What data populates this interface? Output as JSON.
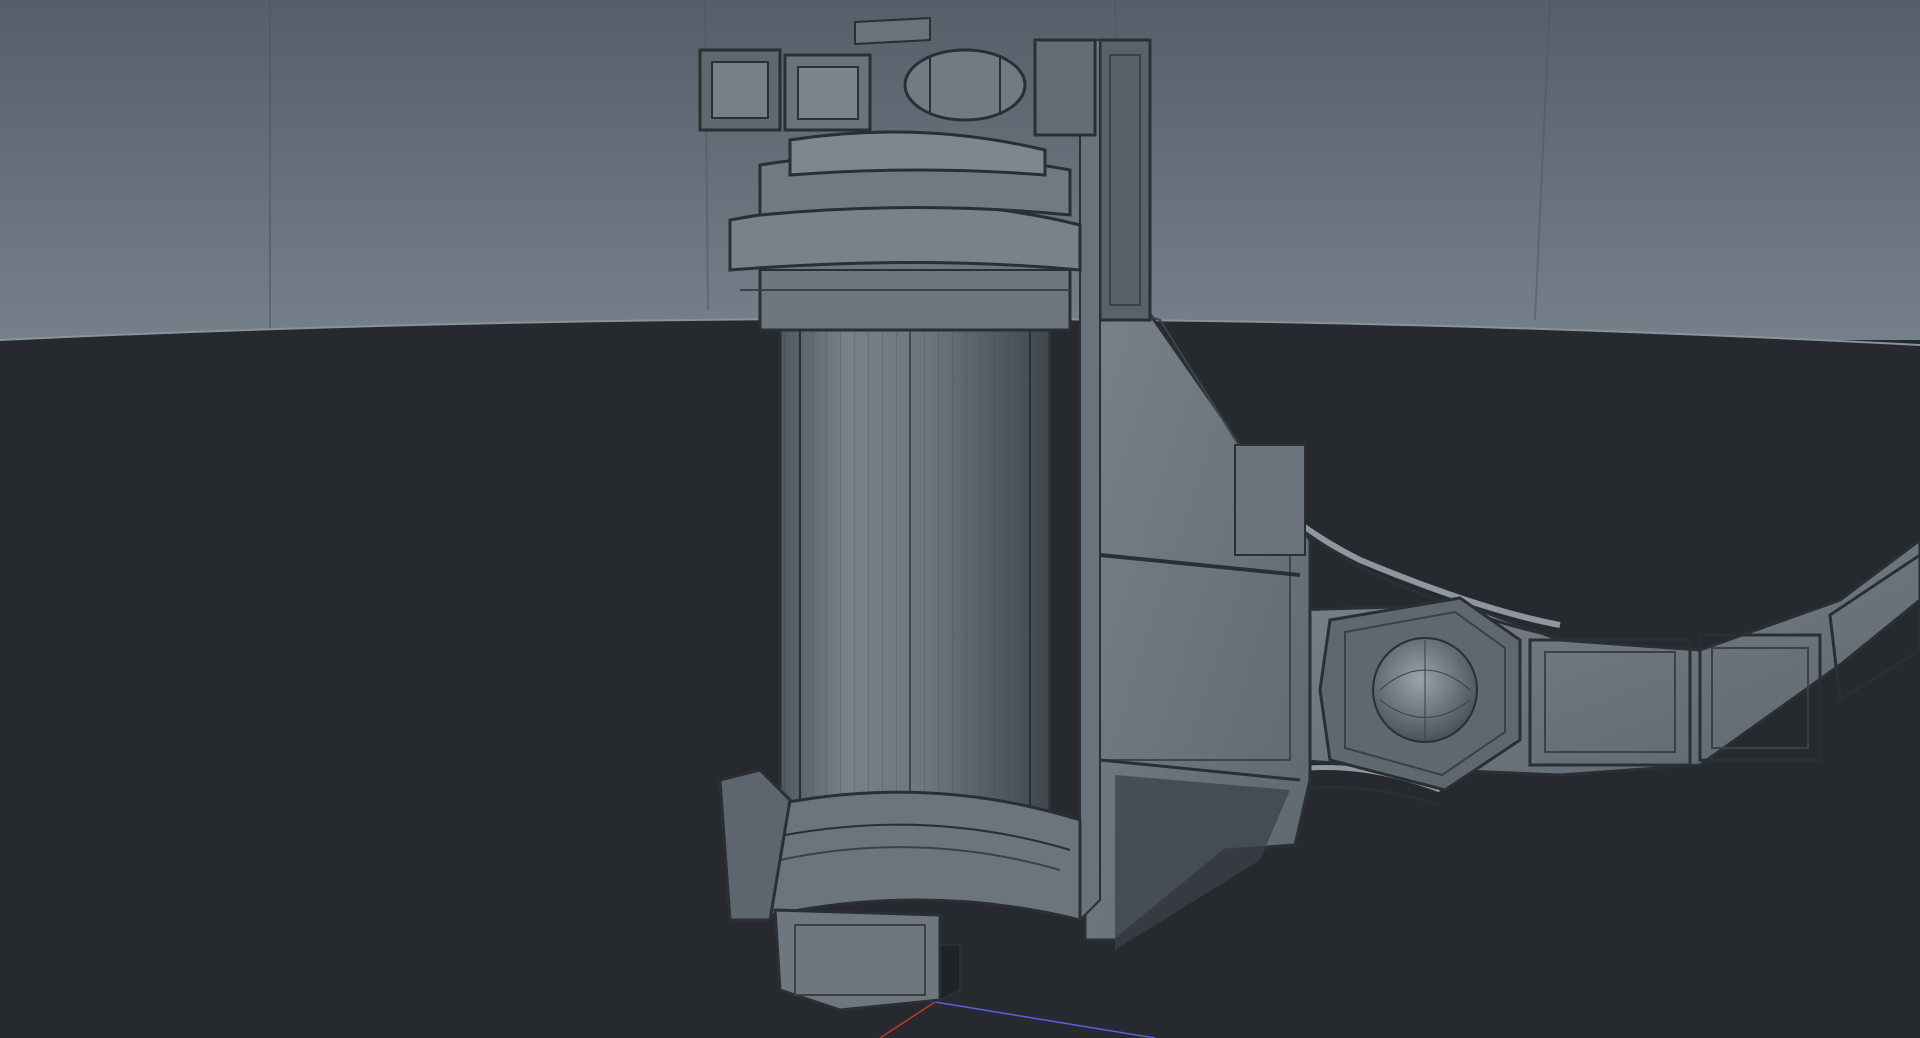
{
  "viewport": {
    "view": "perspective",
    "shading": "wireframe-on-shaded",
    "colors": {
      "backdrop_top": "#5d6670",
      "backdrop_horizon": "#737c86",
      "floor": "#262a2f",
      "model_fill": "#6e777f",
      "model_dark": "#4e565d",
      "wire": "#2a2f34",
      "axis_x": "#c0392b",
      "axis_z": "#5c5fe0"
    },
    "objects": [
      {
        "name": "gas-canister-cylinder"
      },
      {
        "name": "canister-top-valve-assembly"
      },
      {
        "name": "canister-bottom-base-clamp"
      },
      {
        "name": "mounting-bracket-plate"
      },
      {
        "name": "harness-strap-segments"
      },
      {
        "name": "strap-pivot-joint-sphere"
      }
    ]
  }
}
